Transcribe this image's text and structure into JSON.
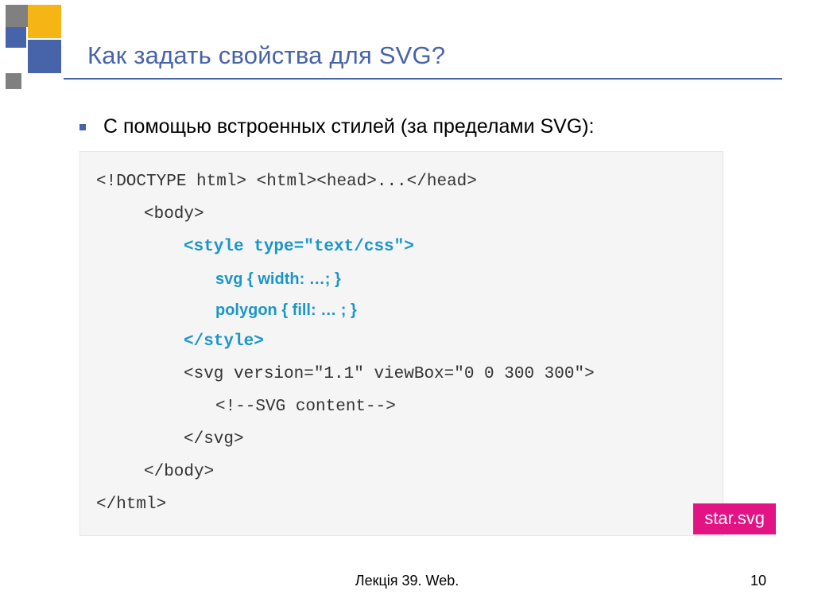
{
  "title": "Как задать свойства для SVG?",
  "bullet": "С помощью встроенных стилей (за пределами SVG):",
  "code": {
    "l1": "<!DOCTYPE html> <html><head>...</head>",
    "l2": "<body>",
    "l3": "<style type=\"text/css\">",
    "l4": "svg { width: …; }",
    "l5": "polygon { fill: … ; }",
    "l6": "</style>",
    "l7": "<svg version=\"1.1\" viewBox=\"0 0 300 300\">",
    "l8": "<!--SVG content-->",
    "l9": "</svg>",
    "l10": "</body>",
    "l11": "</html>"
  },
  "badge": "star.svg",
  "footer": "Лекція 39. Web.",
  "page": "10"
}
